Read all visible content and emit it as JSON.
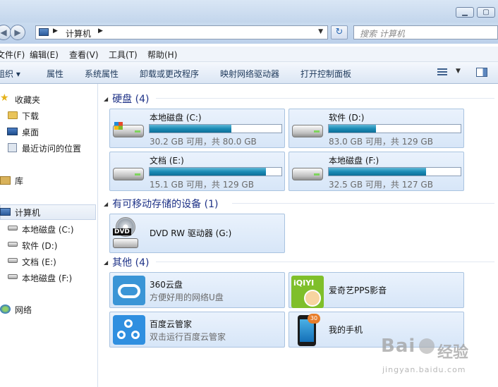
{
  "window": {
    "minimize_glyph": "▁",
    "maximize_glyph": "▢"
  },
  "address": {
    "path_item": "计算机",
    "search_placeholder": "搜索 计算机",
    "refresh_glyph": "↻"
  },
  "menu": {
    "items": [
      "文件(F)",
      "编辑(E)",
      "查看(V)",
      "工具(T)",
      "帮助(H)"
    ]
  },
  "toolbar": {
    "organize": "组织 ▾",
    "items": [
      "属性",
      "系统属性",
      "卸载或更改程序",
      "映射网络驱动器",
      "打开控制面板"
    ]
  },
  "nav": {
    "favorites": "收藏夹",
    "fav_items": [
      "下载",
      "桌面",
      "最近访问的位置"
    ],
    "libraries": "库",
    "computer": "计算机",
    "computer_items": [
      "本地磁盘 (C:)",
      "软件 (D:)",
      "文档 (E:)",
      "本地磁盘 (F:)"
    ],
    "network": "网络"
  },
  "groups": {
    "hdd": "硬盘 (4)",
    "removable": "有可移动存储的设备 (1)",
    "other": "其他 (4)"
  },
  "drives": [
    {
      "name": "本地磁盘 (C:)",
      "info": "30.2 GB 可用，共 80.0 GB",
      "used_fraction": 0.62
    },
    {
      "name": "软件 (D:)",
      "info": "83.0 GB 可用，共 129 GB",
      "used_fraction": 0.36
    },
    {
      "name": "文档 (E:)",
      "info": "15.1 GB 可用，共 129 GB",
      "used_fraction": 0.88
    },
    {
      "name": "本地磁盘 (F:)",
      "info": "32.5 GB 可用，共 127 GB",
      "used_fraction": 0.74
    }
  ],
  "removable": {
    "name": "DVD RW 驱动器 (G:)",
    "icon_label": "DVD"
  },
  "others": [
    {
      "name": "360云盘",
      "sub": "方便好用的网络U盘"
    },
    {
      "name": "爱奇艺PPS影音",
      "sub": ""
    },
    {
      "name": "百度云管家",
      "sub": "双击运行百度云管家"
    },
    {
      "name": "我的手机",
      "sub": "",
      "badge": "30"
    }
  ],
  "watermark": {
    "brand": "Bai",
    "brand2": "经验",
    "url": "jingyan.baidu.com"
  }
}
